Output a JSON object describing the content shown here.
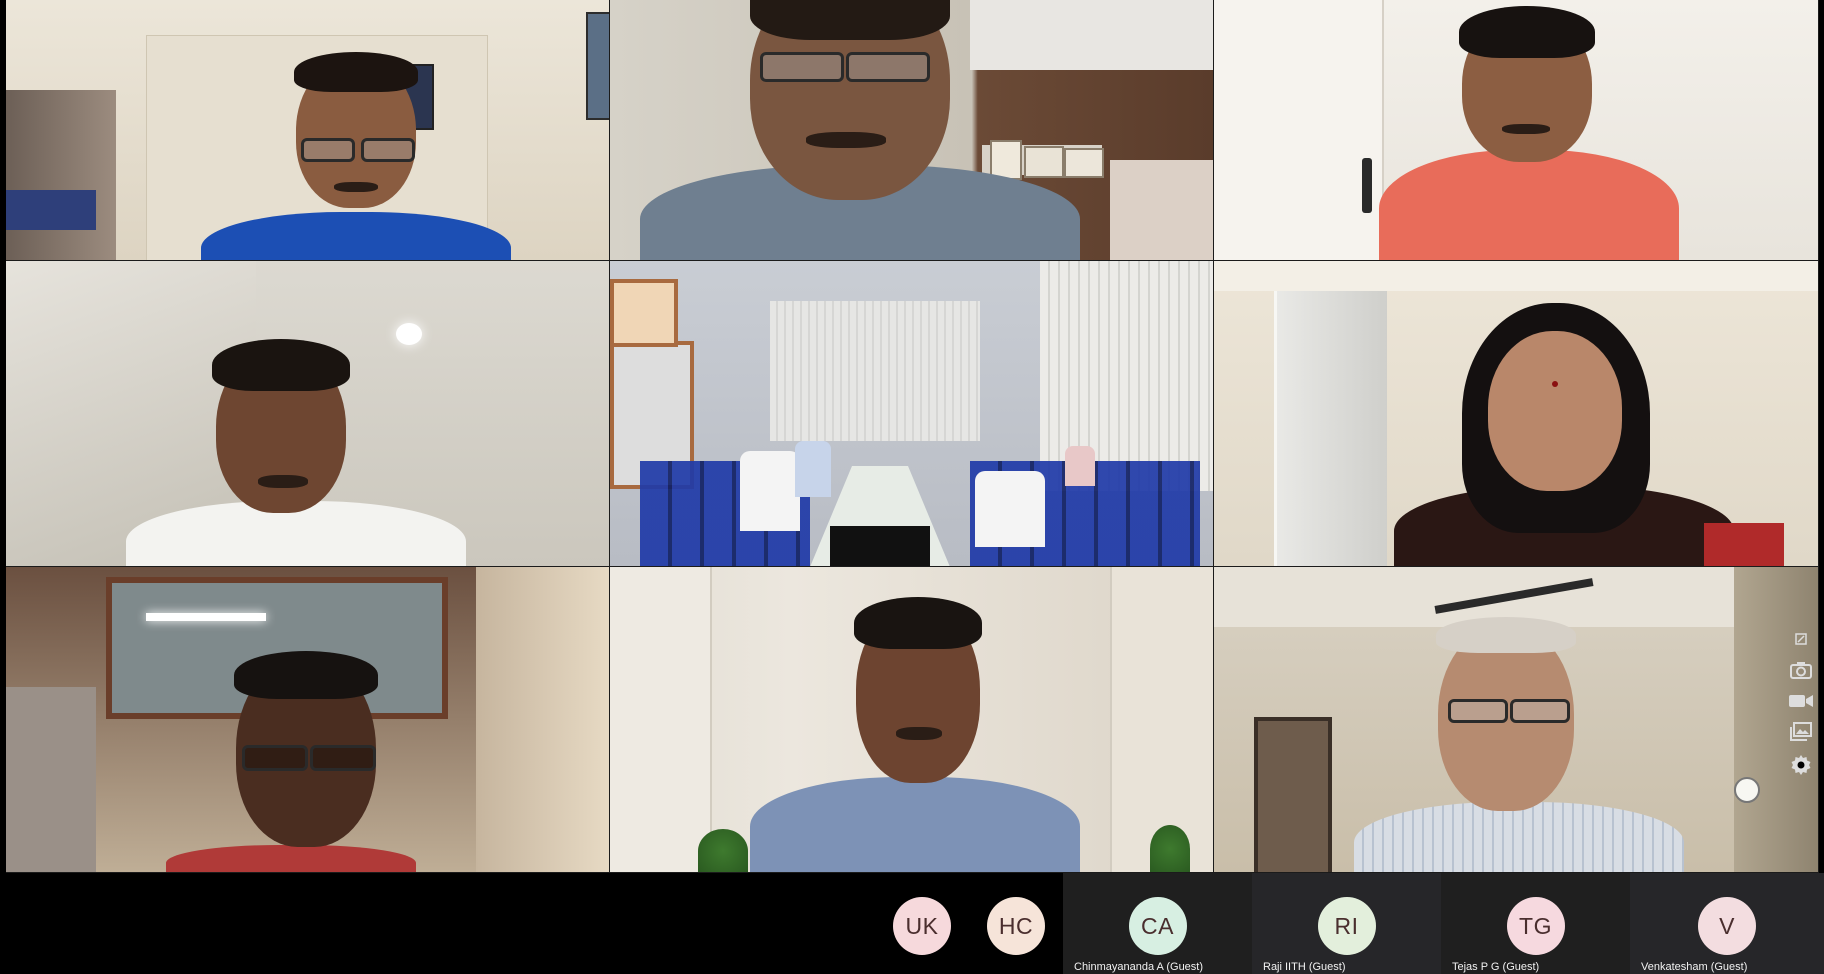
{
  "window": {
    "grid_tiles": [
      {
        "id": "tile-1",
        "label": ""
      },
      {
        "id": "tile-2",
        "label": ""
      },
      {
        "id": "tile-3",
        "label": ""
      },
      {
        "id": "tile-4",
        "label": ""
      },
      {
        "id": "tile-5",
        "label": ""
      },
      {
        "id": "tile-6",
        "label": ""
      },
      {
        "id": "tile-7",
        "label": ""
      },
      {
        "id": "tile-8",
        "label": ""
      },
      {
        "id": "tile-9",
        "label": ""
      }
    ]
  },
  "side_controls": {
    "icons": [
      "pin-icon",
      "snapshot-camera-icon",
      "video-camera-icon",
      "gallery-icon",
      "settings-gear-icon"
    ]
  },
  "participants": [
    {
      "initials": "UK",
      "name": "",
      "avatar_color": "#f6d9dc"
    },
    {
      "initials": "HC",
      "name": "",
      "avatar_color": "#f6e4d9"
    },
    {
      "initials": "CA",
      "name": "Chinmayananda A (Guest)",
      "avatar_color": "#d7efe2"
    },
    {
      "initials": "RI",
      "name": "Raji IITH (Guest)",
      "avatar_color": "#e3efdc"
    },
    {
      "initials": "TG",
      "name": "Tejas P G (Guest)",
      "avatar_color": "#f6d9df"
    },
    {
      "initials": "V",
      "name": "Venkatesham (Guest)",
      "avatar_color": "#f3dde0"
    }
  ],
  "colors": {
    "background": "#000000",
    "card_dark": "#1f1f1f",
    "avatar_text": "#4a2e2e",
    "name_text": "#f2f2f2"
  }
}
